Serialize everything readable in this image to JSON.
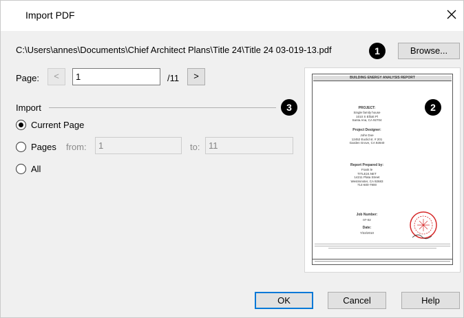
{
  "window": {
    "title": "Import PDF"
  },
  "file": {
    "path": "C:\\Users\\annes\\Documents\\Chief Architect Plans\\Title 24\\Title 24 03-019-13.pdf",
    "browse_label": "Browse..."
  },
  "callouts": {
    "one": "1",
    "two": "2",
    "three": "3"
  },
  "page": {
    "label": "Page:",
    "prev": "<",
    "value": "1",
    "total": "/11",
    "next": ">"
  },
  "import": {
    "label": "Import",
    "current_page": "Current Page",
    "pages": "Pages",
    "from_label": "from:",
    "from_value": "1",
    "to_label": "to:",
    "to_value": "11",
    "all": "All",
    "selected": "current_page"
  },
  "report": {
    "header": "BUILDING ENERGY ANALYSIS REPORT",
    "project_label": "PROJECT:",
    "project_lines": [
      "Single family house",
      "1010 S Elliott Pl",
      "Santa Ana, CA 92704"
    ],
    "designer_label": "Project Designer:",
    "designer_lines": [
      "John Doe",
      "12452 Euclid st. # 201",
      "Garden Grove, CA 92840"
    ],
    "prepared_label": "Report Prepared by:",
    "prepared_lines": [
      "Frank le",
      "TITLE24.NET",
      "14211 Plata Street",
      "Westminster, CA 92683",
      "714-600-7900"
    ],
    "job_label": "Job Number:",
    "job_value": "07-02",
    "date_label": "Date:",
    "date_value": "7/22/2010"
  },
  "buttons": {
    "ok": "OK",
    "cancel": "Cancel",
    "help": "Help"
  },
  "colors": {
    "accent": "#0078d7",
    "dialog_bg": "#f0f0f0",
    "stamp": "#d62828"
  }
}
